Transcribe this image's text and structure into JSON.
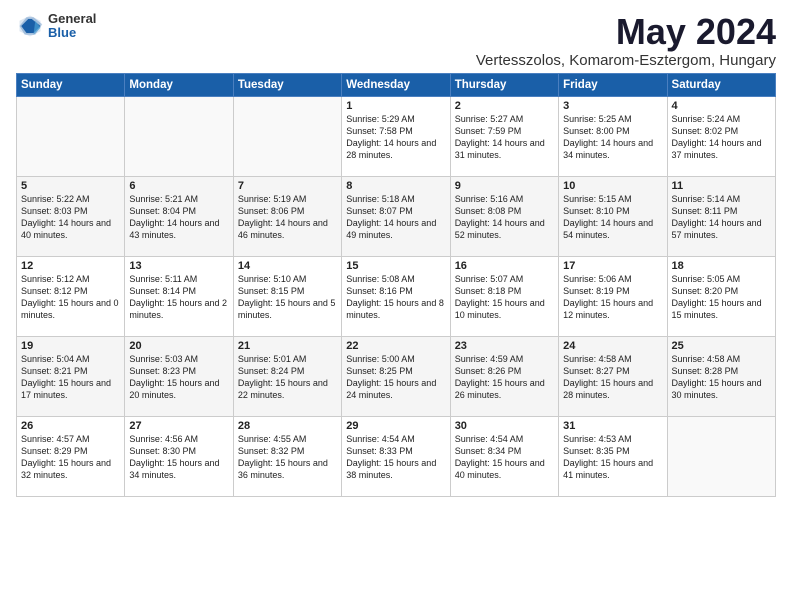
{
  "logo": {
    "general": "General",
    "blue": "Blue"
  },
  "title": "May 2024",
  "subtitle": "Vertesszolos, Komarom-Esztergom, Hungary",
  "days_of_week": [
    "Sunday",
    "Monday",
    "Tuesday",
    "Wednesday",
    "Thursday",
    "Friday",
    "Saturday"
  ],
  "weeks": [
    [
      {
        "day": "",
        "info": ""
      },
      {
        "day": "",
        "info": ""
      },
      {
        "day": "",
        "info": ""
      },
      {
        "day": "1",
        "info": "Sunrise: 5:29 AM\nSunset: 7:58 PM\nDaylight: 14 hours\nand 28 minutes."
      },
      {
        "day": "2",
        "info": "Sunrise: 5:27 AM\nSunset: 7:59 PM\nDaylight: 14 hours\nand 31 minutes."
      },
      {
        "day": "3",
        "info": "Sunrise: 5:25 AM\nSunset: 8:00 PM\nDaylight: 14 hours\nand 34 minutes."
      },
      {
        "day": "4",
        "info": "Sunrise: 5:24 AM\nSunset: 8:02 PM\nDaylight: 14 hours\nand 37 minutes."
      }
    ],
    [
      {
        "day": "5",
        "info": "Sunrise: 5:22 AM\nSunset: 8:03 PM\nDaylight: 14 hours\nand 40 minutes."
      },
      {
        "day": "6",
        "info": "Sunrise: 5:21 AM\nSunset: 8:04 PM\nDaylight: 14 hours\nand 43 minutes."
      },
      {
        "day": "7",
        "info": "Sunrise: 5:19 AM\nSunset: 8:06 PM\nDaylight: 14 hours\nand 46 minutes."
      },
      {
        "day": "8",
        "info": "Sunrise: 5:18 AM\nSunset: 8:07 PM\nDaylight: 14 hours\nand 49 minutes."
      },
      {
        "day": "9",
        "info": "Sunrise: 5:16 AM\nSunset: 8:08 PM\nDaylight: 14 hours\nand 52 minutes."
      },
      {
        "day": "10",
        "info": "Sunrise: 5:15 AM\nSunset: 8:10 PM\nDaylight: 14 hours\nand 54 minutes."
      },
      {
        "day": "11",
        "info": "Sunrise: 5:14 AM\nSunset: 8:11 PM\nDaylight: 14 hours\nand 57 minutes."
      }
    ],
    [
      {
        "day": "12",
        "info": "Sunrise: 5:12 AM\nSunset: 8:12 PM\nDaylight: 15 hours\nand 0 minutes."
      },
      {
        "day": "13",
        "info": "Sunrise: 5:11 AM\nSunset: 8:14 PM\nDaylight: 15 hours\nand 2 minutes."
      },
      {
        "day": "14",
        "info": "Sunrise: 5:10 AM\nSunset: 8:15 PM\nDaylight: 15 hours\nand 5 minutes."
      },
      {
        "day": "15",
        "info": "Sunrise: 5:08 AM\nSunset: 8:16 PM\nDaylight: 15 hours\nand 8 minutes."
      },
      {
        "day": "16",
        "info": "Sunrise: 5:07 AM\nSunset: 8:18 PM\nDaylight: 15 hours\nand 10 minutes."
      },
      {
        "day": "17",
        "info": "Sunrise: 5:06 AM\nSunset: 8:19 PM\nDaylight: 15 hours\nand 12 minutes."
      },
      {
        "day": "18",
        "info": "Sunrise: 5:05 AM\nSunset: 8:20 PM\nDaylight: 15 hours\nand 15 minutes."
      }
    ],
    [
      {
        "day": "19",
        "info": "Sunrise: 5:04 AM\nSunset: 8:21 PM\nDaylight: 15 hours\nand 17 minutes."
      },
      {
        "day": "20",
        "info": "Sunrise: 5:03 AM\nSunset: 8:23 PM\nDaylight: 15 hours\nand 20 minutes."
      },
      {
        "day": "21",
        "info": "Sunrise: 5:01 AM\nSunset: 8:24 PM\nDaylight: 15 hours\nand 22 minutes."
      },
      {
        "day": "22",
        "info": "Sunrise: 5:00 AM\nSunset: 8:25 PM\nDaylight: 15 hours\nand 24 minutes."
      },
      {
        "day": "23",
        "info": "Sunrise: 4:59 AM\nSunset: 8:26 PM\nDaylight: 15 hours\nand 26 minutes."
      },
      {
        "day": "24",
        "info": "Sunrise: 4:58 AM\nSunset: 8:27 PM\nDaylight: 15 hours\nand 28 minutes."
      },
      {
        "day": "25",
        "info": "Sunrise: 4:58 AM\nSunset: 8:28 PM\nDaylight: 15 hours\nand 30 minutes."
      }
    ],
    [
      {
        "day": "26",
        "info": "Sunrise: 4:57 AM\nSunset: 8:29 PM\nDaylight: 15 hours\nand 32 minutes."
      },
      {
        "day": "27",
        "info": "Sunrise: 4:56 AM\nSunset: 8:30 PM\nDaylight: 15 hours\nand 34 minutes."
      },
      {
        "day": "28",
        "info": "Sunrise: 4:55 AM\nSunset: 8:32 PM\nDaylight: 15 hours\nand 36 minutes."
      },
      {
        "day": "29",
        "info": "Sunrise: 4:54 AM\nSunset: 8:33 PM\nDaylight: 15 hours\nand 38 minutes."
      },
      {
        "day": "30",
        "info": "Sunrise: 4:54 AM\nSunset: 8:34 PM\nDaylight: 15 hours\nand 40 minutes."
      },
      {
        "day": "31",
        "info": "Sunrise: 4:53 AM\nSunset: 8:35 PM\nDaylight: 15 hours\nand 41 minutes."
      },
      {
        "day": "",
        "info": ""
      }
    ]
  ]
}
